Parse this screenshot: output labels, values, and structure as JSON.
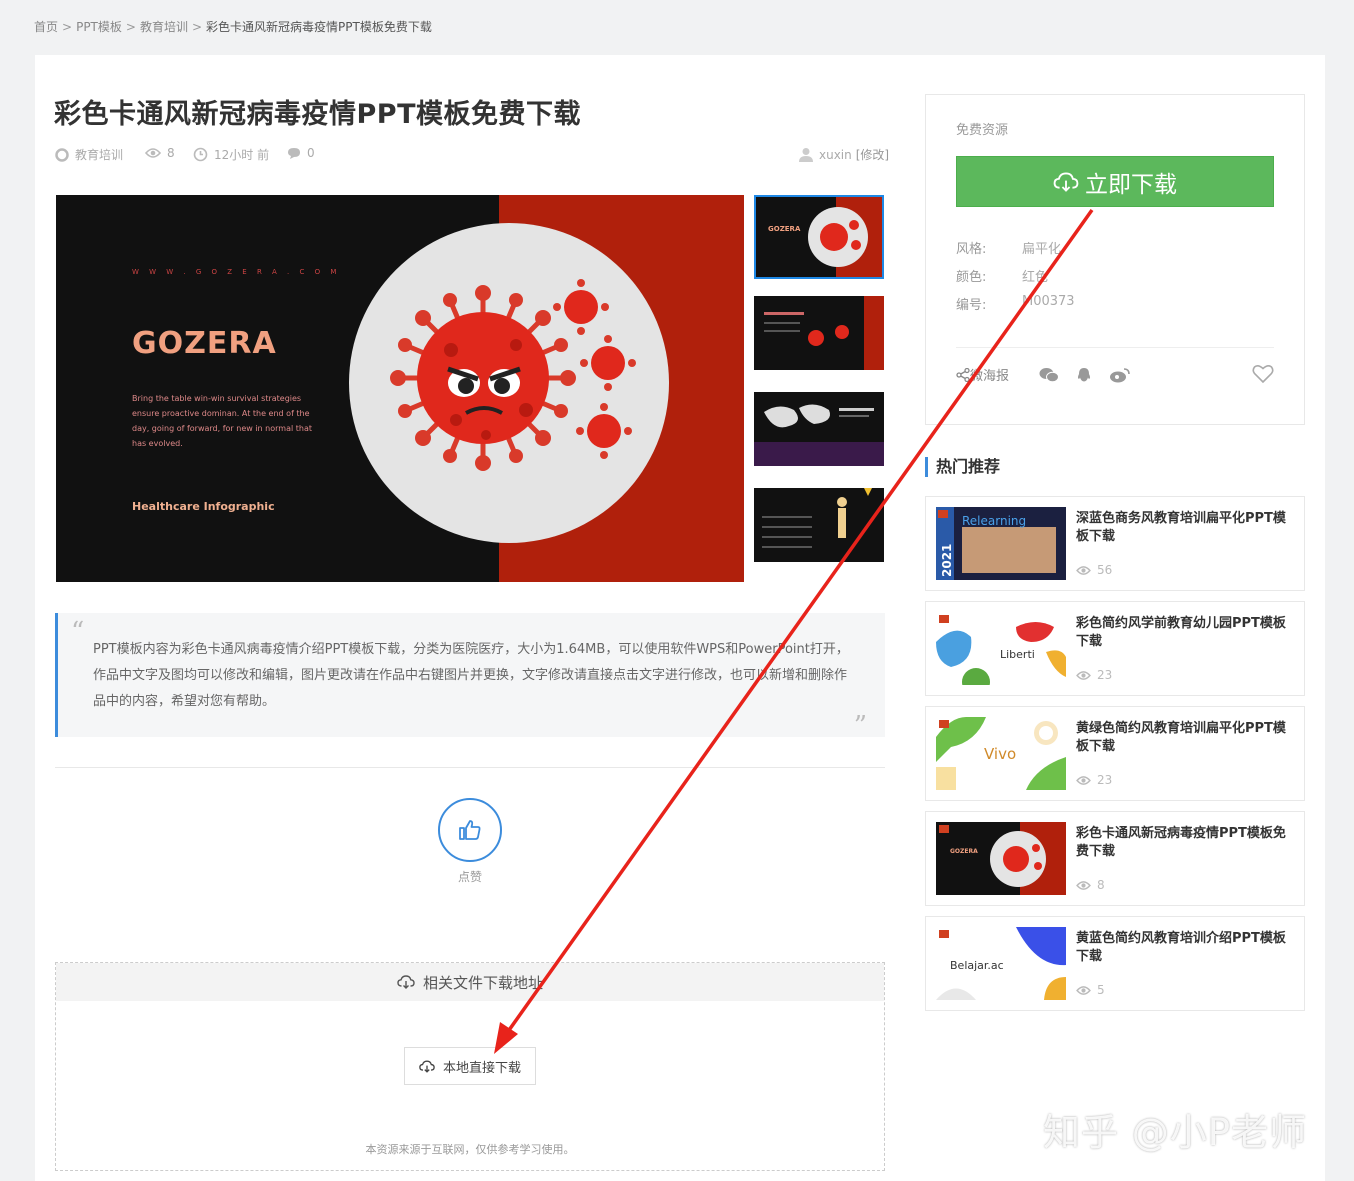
{
  "breadcrumb": {
    "home": "首页",
    "sep": ">",
    "level1": "PPT模板",
    "level2": "教育培训",
    "current": "彩色卡通风新冠病毒疫情PPT模板免费下载"
  },
  "article": {
    "title": "彩色卡通风新冠病毒疫情PPT模板免费下载",
    "category": "教育培训",
    "views": "8",
    "time": "12小时 前",
    "comments": "0",
    "author": "xuxin",
    "edit_label": "[修改]"
  },
  "preview": {
    "url_text": "W W W . G O Z E R A . C O M",
    "brand": "GOZERA",
    "desc": "Bring the table win-win survival strategies ensure proactive dominan. At the end of the day, going of forward, for new in normal that has evolved.",
    "subtitle": "Healthcare Infographic"
  },
  "description": {
    "open_quote": "“",
    "text": "PPT模板内容为彩色卡通风病毒疫情介绍PPT模板下载，分类为医院医疗，大小为1.64MB，可以使用软件WPS和PowerPoint打开， 作品中文字及图均可以修改和编辑，图片更改请在作品中右键图片并更换，文字修改请直接点击文字进行修改，也可以新增和删除作品中的内容，希望对您有帮助。",
    "close_quote": "”"
  },
  "like": {
    "label": "点赞"
  },
  "download_box": {
    "heading": "相关文件下载地址",
    "local_button": "本地直接下载",
    "note": "本资源来源于互联网，仅供参考学习使用。"
  },
  "sidebar": {
    "free_label": "免费资源",
    "download_button": "立即下载",
    "props": [
      {
        "label": "风格:",
        "value": "扁平化"
      },
      {
        "label": "颜色:",
        "value": "红色"
      },
      {
        "label": "编号:",
        "value": "M00373"
      }
    ],
    "share_label": "微海报"
  },
  "hot": {
    "title": "热门推荐",
    "items": [
      {
        "title": "深蓝色商务风教育培训扁平化PPT模板下载",
        "views": "56",
        "thumb_text": "Relearning",
        "year": "2021"
      },
      {
        "title": "彩色简约风学前教育幼儿园PPT模板下载",
        "views": "23",
        "thumb_text": "Liberti"
      },
      {
        "title": "黄绿色简约风教育培训扁平化PPT模板下载",
        "views": "23",
        "thumb_text": "Vivo"
      },
      {
        "title": "彩色卡通风新冠病毒疫情PPT模板免费下载",
        "views": "8",
        "thumb_text": "GOZERA"
      },
      {
        "title": "黄蓝色简约风教育培训介绍PPT模板下载",
        "views": "5",
        "thumb_text": "Belajar.ac"
      }
    ]
  },
  "watermark": "知乎 @小P老师",
  "colors": {
    "accent": "#3c8cdc",
    "download_green": "#5cb85c",
    "annotation_red": "#e8231b"
  }
}
